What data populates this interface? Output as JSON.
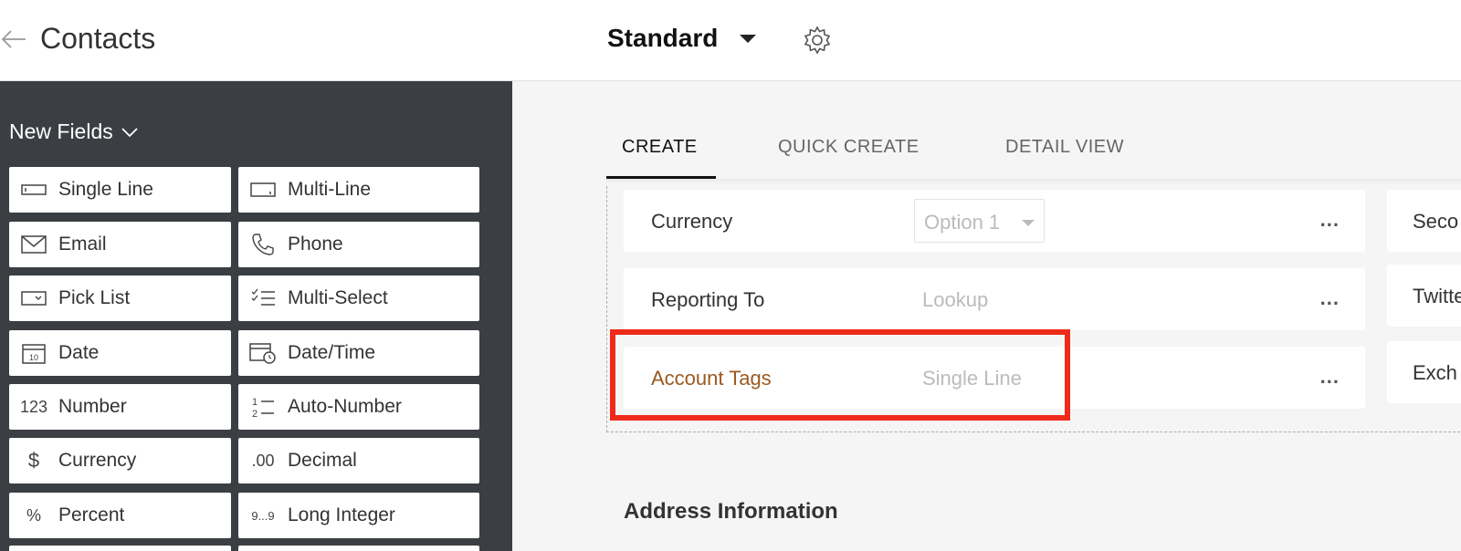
{
  "header": {
    "title": "Contacts",
    "layout_name": "Standard"
  },
  "sidebar": {
    "title": "New Fields",
    "fields": [
      {
        "label": "Single Line",
        "icon": "single-line-icon"
      },
      {
        "label": "Multi-Line",
        "icon": "multi-line-icon"
      },
      {
        "label": "Email",
        "icon": "email-icon"
      },
      {
        "label": "Phone",
        "icon": "phone-icon"
      },
      {
        "label": "Pick List",
        "icon": "pick-list-icon"
      },
      {
        "label": "Multi-Select",
        "icon": "multi-select-icon"
      },
      {
        "label": "Date",
        "icon": "date-icon"
      },
      {
        "label": "Date/Time",
        "icon": "date-time-icon"
      },
      {
        "label": "Number",
        "icon": "number-icon",
        "glyph": "123"
      },
      {
        "label": "Auto-Number",
        "icon": "auto-number-icon"
      },
      {
        "label": "Currency",
        "icon": "currency-icon",
        "glyph": "$"
      },
      {
        "label": "Decimal",
        "icon": "decimal-icon",
        "glyph": ".00"
      },
      {
        "label": "Percent",
        "icon": "percent-icon",
        "glyph": "%"
      },
      {
        "label": "Long Integer",
        "icon": "long-integer-icon",
        "glyph": "9...9"
      }
    ]
  },
  "tabs": [
    {
      "label": "CREATE",
      "active": true
    },
    {
      "label": "QUICK CREATE",
      "active": false
    },
    {
      "label": "DETAIL VIEW",
      "active": false
    }
  ],
  "rows": [
    {
      "label": "Currency",
      "value": "Option 1",
      "type": "select"
    },
    {
      "label": "Reporting To",
      "value": "Lookup",
      "type": "lookup"
    },
    {
      "label": "Account Tags",
      "value": "Single Line",
      "type": "single-line"
    }
  ],
  "right_rows": [
    "Seco",
    "Twitte",
    "Exch"
  ],
  "more_label": "...",
  "section": {
    "title": "Address Information"
  },
  "colors": {
    "highlight": "#ee2b1b",
    "sidebar_bg": "#3b3e42",
    "new_field_label": "#9a5a20"
  }
}
